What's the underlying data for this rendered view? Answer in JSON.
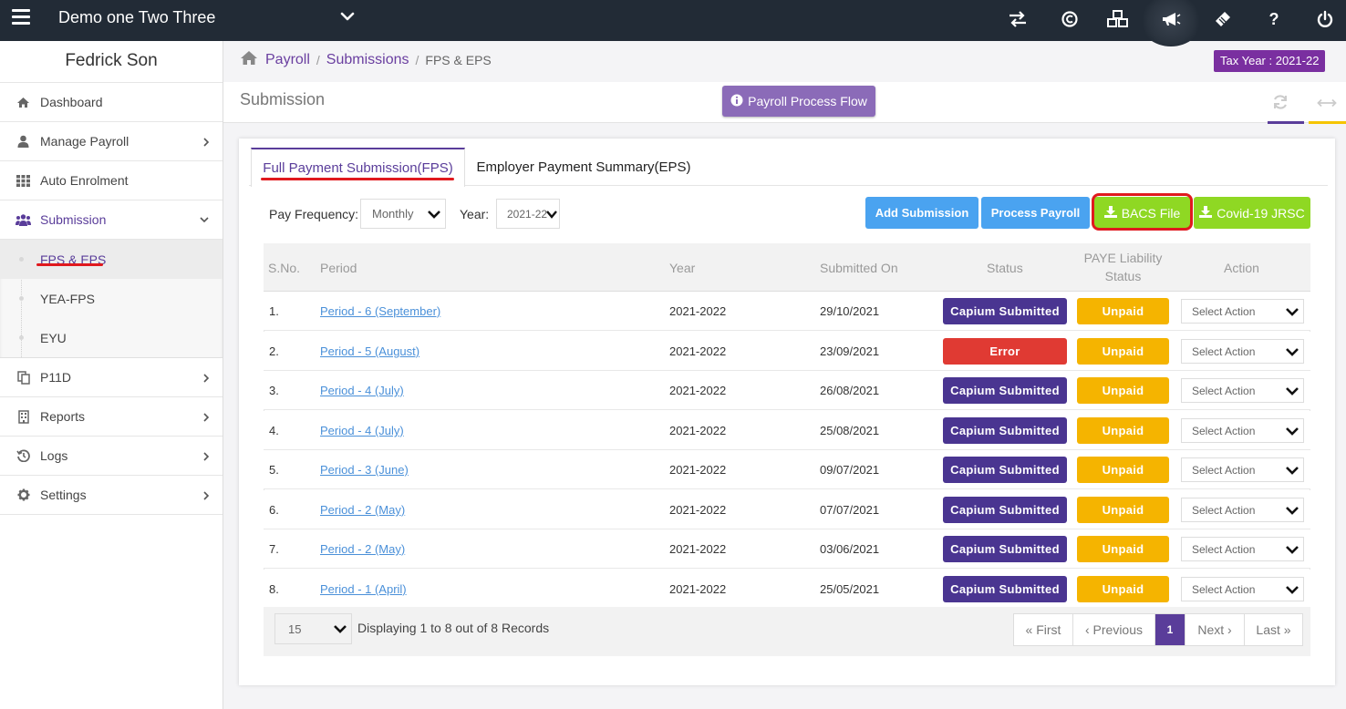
{
  "topbar": {
    "company": "Demo one Two Three",
    "icons": [
      "exchange-icon",
      "capium-c-icon",
      "cubes-icon",
      "bullhorn-icon",
      "ticket-icon",
      "question-icon",
      "power-icon"
    ],
    "help_label": "?"
  },
  "sidebar": {
    "user": "Fedrick Son",
    "items": [
      {
        "label": "Dashboard",
        "icon": "home-icon"
      },
      {
        "label": "Manage Payroll",
        "icon": "user-icon"
      },
      {
        "label": "Auto Enrolment",
        "icon": "grid-icon"
      },
      {
        "label": "Submission",
        "icon": "users-icon"
      },
      {
        "label": "P11D",
        "icon": "copy-icon"
      },
      {
        "label": "Reports",
        "icon": "building-icon"
      },
      {
        "label": "Logs",
        "icon": "history-icon"
      },
      {
        "label": "Settings",
        "icon": "gear-icon"
      }
    ],
    "subitems": [
      {
        "label": "FPS & EPS"
      },
      {
        "label": "YEA-FPS"
      },
      {
        "label": "EYU"
      }
    ]
  },
  "breadcrumb": {
    "root": "Payroll",
    "middle": "Submissions",
    "current": "FPS & EPS",
    "sep": "/"
  },
  "tax_year": "Tax Year : 2021-22",
  "page_title": "Submission",
  "process_flow_button": "Payroll Process Flow",
  "tabs": [
    {
      "label": "Full Payment Submission(FPS)"
    },
    {
      "label": "Employer Payment Summary(EPS)"
    }
  ],
  "filters": {
    "pay_frequency_label": "Pay Frequency:",
    "pay_frequency_value": "Monthly",
    "year_label": "Year:",
    "year_value": "2021-22"
  },
  "buttons": {
    "add_submission": "Add Submission",
    "process_payroll": "Process Payroll",
    "bacs_file": "BACS File",
    "covid": "Covid-19 JRSC"
  },
  "table": {
    "headers": {
      "sno": "S.No.",
      "period": "Period",
      "year": "Year",
      "submitted_on": "Submitted On",
      "status": "Status",
      "paye_1": "PAYE Liability",
      "paye_2": "Status",
      "action": "Action"
    },
    "rows": [
      {
        "sno": "1.",
        "period": "Period - 6 (September)",
        "year": "2021-2022",
        "submitted": "29/10/2021",
        "status": "Capium Submitted",
        "paye": "Unpaid",
        "action": "Select Action"
      },
      {
        "sno": "2.",
        "period": "Period - 5 (August)",
        "year": "2021-2022",
        "submitted": "23/09/2021",
        "status": "Error",
        "paye": "Unpaid",
        "action": "Select Action"
      },
      {
        "sno": "3.",
        "period": "Period - 4 (July)",
        "year": "2021-2022",
        "submitted": "26/08/2021",
        "status": "Capium Submitted",
        "paye": "Unpaid",
        "action": "Select Action"
      },
      {
        "sno": "4.",
        "period": "Period - 4 (July)",
        "year": "2021-2022",
        "submitted": "25/08/2021",
        "status": "Capium Submitted",
        "paye": "Unpaid",
        "action": "Select Action"
      },
      {
        "sno": "5.",
        "period": "Period - 3 (June)",
        "year": "2021-2022",
        "submitted": "09/07/2021",
        "status": "Capium Submitted",
        "paye": "Unpaid",
        "action": "Select Action"
      },
      {
        "sno": "6.",
        "period": "Period - 2 (May)",
        "year": "2021-2022",
        "submitted": "07/07/2021",
        "status": "Capium Submitted",
        "paye": "Unpaid",
        "action": "Select Action"
      },
      {
        "sno": "7.",
        "period": "Period - 2 (May)",
        "year": "2021-2022",
        "submitted": "03/06/2021",
        "status": "Capium Submitted",
        "paye": "Unpaid",
        "action": "Select Action"
      },
      {
        "sno": "8.",
        "period": "Period - 1 (April)",
        "year": "2021-2022",
        "submitted": "25/05/2021",
        "status": "Capium Submitted",
        "paye": "Unpaid",
        "action": "Select Action"
      }
    ]
  },
  "footer": {
    "page_size": "15",
    "display_text": "Displaying 1 to 8 out of 8 Records",
    "first": "« First",
    "previous": "‹ Previous",
    "page": "1",
    "next": "Next ›",
    "last": "Last »"
  },
  "colors": {
    "topbar": "#222b36",
    "accent_purple": "#5a3d9a",
    "badge_purple": "#4a3591",
    "badge_error": "#e03a33",
    "badge_unpaid": "#f5b400",
    "btn_blue": "#4aa3f0",
    "btn_green": "#8fd823",
    "annotation_red": "#e0191e"
  }
}
